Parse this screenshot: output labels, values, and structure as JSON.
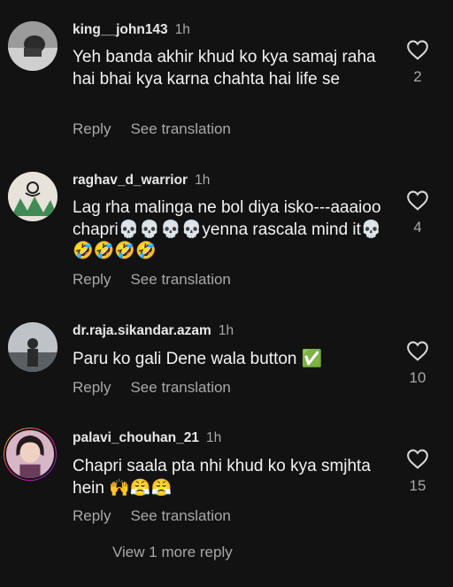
{
  "comments": [
    {
      "username": "king__john143",
      "time": "1h",
      "text": "Yeh banda akhir khud ko kya samaj raha hai bhai kya karna chahta hai life se",
      "reply": "Reply",
      "translate": "See translation",
      "likes": "2"
    },
    {
      "username": "raghav_d_warrior",
      "time": "1h",
      "text": "Lag rha malinga ne bol diya isko---aaaioo chapri💀💀💀💀yenna rascala mind it💀🤣🤣🤣🤣",
      "reply": "Reply",
      "translate": "See translation",
      "likes": "4"
    },
    {
      "username": "dr.raja.sikandar.azam",
      "time": "1h",
      "text": "Paru ko gali Dene wala button ✅",
      "reply": "Reply",
      "translate": "See translation",
      "likes": "10"
    },
    {
      "username": "palavi_chouhan_21",
      "time": "1h",
      "text": "Chapri saala pta nhi khud ko kya smjhta hein 🙌😤😤",
      "reply": "Reply",
      "translate": "See translation",
      "likes": "15"
    }
  ],
  "view_more": "View 1 more reply"
}
